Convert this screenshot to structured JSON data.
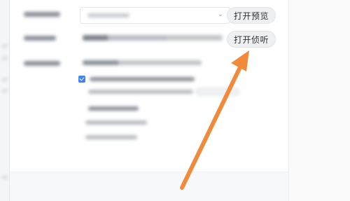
{
  "settings": {
    "buttons": {
      "open_preview": "打开预览",
      "open_listen": "打开侦听"
    },
    "select": {
      "chevron": "⌄"
    }
  },
  "colors": {
    "accent_checkbox": "#3f84f7",
    "annotation_arrow": "#f18a3a",
    "button_bg": "#eff0f2"
  },
  "icons": {
    "dropdown": "chevron-down-icon",
    "checkbox": "checkbox-checked-icon",
    "annotation": "arrow-annotation-icon"
  }
}
